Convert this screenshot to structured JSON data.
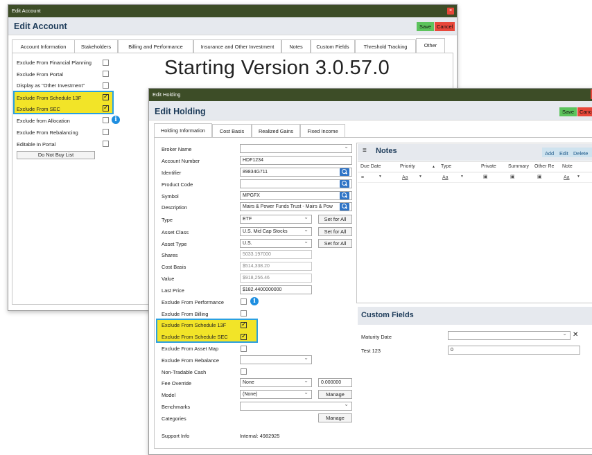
{
  "account": {
    "titlebar": "Edit Account",
    "close": "×",
    "heading": "Edit Account",
    "save": "Save",
    "cancel": "Cancel",
    "tabs": [
      "Account Information",
      "Stakeholders",
      "Billing and Performance",
      "Insurance and Other Investment",
      "Notes",
      "Custom Fields",
      "Threshold Tracking",
      "Other"
    ],
    "rows": [
      {
        "label": "Exclude From Financial Planning",
        "checked": false
      },
      {
        "label": "Exclude From Portal",
        "checked": false
      },
      {
        "label": "Display as \"Other Investment\"",
        "checked": false
      },
      {
        "label": "Exclude From Schedule 13F",
        "checked": true
      },
      {
        "label": "Exclude From SEC",
        "checked": true
      },
      {
        "label": "Exclude from Allocation",
        "checked": false
      },
      {
        "label": "Exclude From Rebalancing",
        "checked": false
      },
      {
        "label": "Editable In Portal",
        "checked": false
      }
    ],
    "donot": "Do Not Buy List",
    "info": "i"
  },
  "version_text": "Starting Version 3.0.57.0",
  "holding": {
    "titlebar": "Edit Holding",
    "heading": "Edit Holding",
    "save": "Save",
    "cancel": "Cancel",
    "tabs": [
      "Holding Information",
      "Cost Basis",
      "Realized Gains",
      "Fixed Income"
    ],
    "fields": {
      "broker_name": "Broker Name",
      "account_number": "Account Number",
      "account_number_val": "HDF1234",
      "identifier": "Identifier",
      "identifier_val": "89834G711",
      "product_code": "Product Code",
      "symbol": "Symbol",
      "symbol_val": "MPGFX",
      "description": "Description",
      "description_val": "Mairs & Power Funds Trust - Mairs & Pow",
      "type": "Type",
      "type_val": "ETF",
      "asset_class": "Asset Class",
      "asset_class_val": "U.S. Mid Cap Stocks",
      "asset_type": "Asset Type",
      "asset_type_val": "U.S.",
      "set_for_all": "Set for All",
      "shares": "Shares",
      "shares_val": "5033.197000",
      "cost_basis": "Cost Basis",
      "cost_basis_val": "$514,338.20",
      "value": "Value",
      "value_val": "$918,256.46",
      "last_price": "Last Price",
      "last_price_val": "$182.4400000000",
      "excl_perf": "Exclude From Performance",
      "excl_billing": "Exclude From Billing",
      "excl_13f": "Exclude From Schedule 13F",
      "excl_sec": "Exclude From Schedule SEC",
      "excl_asset_map": "Exclude From Asset Map",
      "excl_rebalance": "Exclude From Rebalance",
      "non_tradable": "Non-Tradable Cash",
      "fee_override": "Fee Override",
      "fee_override_val": "None",
      "fee_val": "0.000000",
      "model": "Model",
      "model_val": "(None)",
      "manage": "Manage",
      "benchmarks": "Benchmarks",
      "categories": "Categories",
      "support_info": "Support Info",
      "support_info_val": "Internal: 4982925"
    },
    "notes": {
      "title": "Notes",
      "menu": "≡",
      "add": "Add",
      "edit": "Edit",
      "delete": "Delete",
      "cols": [
        "Due Date",
        "Priority",
        "Type",
        "Private",
        "Summary",
        "Other Re",
        "Note"
      ],
      "sort": "▲",
      "filter": "▼"
    },
    "custom": {
      "title": "Custom Fields",
      "maturity": "Maturity Date",
      "clear": "✕",
      "test": "Test 123",
      "test_val": "0"
    }
  },
  "colors": {
    "titlebar": "#3d4d27",
    "highlight": "#f2e428",
    "outline": "#2aa0e0",
    "save": "#5cc35c",
    "cancel": "#e8473a"
  },
  "icons": [
    "close-icon",
    "info-icon",
    "lookup-icon",
    "menu-icon",
    "filter-icon",
    "chevron-down-icon",
    "clear-icon"
  ]
}
